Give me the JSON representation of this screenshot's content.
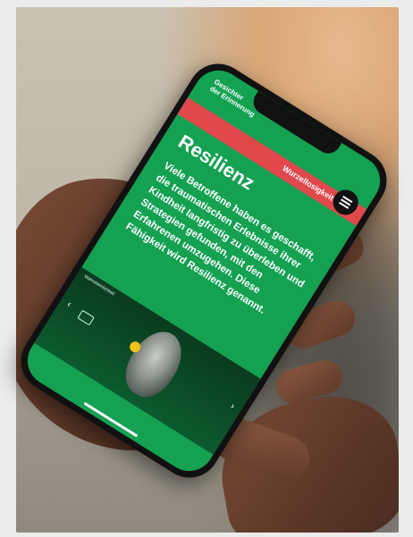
{
  "app": {
    "title_line1": "Gesichter",
    "title_line2": "der Erinnerung"
  },
  "banner": {
    "label": "Wurzellosigkeit",
    "chevron": "›"
  },
  "menu": {
    "icon": "hamburger-menu-icon"
  },
  "content": {
    "heading": "Resilienz",
    "body": "Viele Betroffene haben es geschafft, die traumatischen Erlebnisse ihrer Kindheit langfristig zu überleben und Strategien gefunden, mit den Erfahrenen umzugehen. Diese Fähigkeit wird Resilienz genannt."
  },
  "video": {
    "label": "Wahrsheinlichkeit",
    "play_icon": "play-icon",
    "caption_icon": "closed-captions-icon"
  },
  "colors": {
    "screen": "#14a152",
    "banner": "#e0484c",
    "play": "#f2c21a"
  }
}
